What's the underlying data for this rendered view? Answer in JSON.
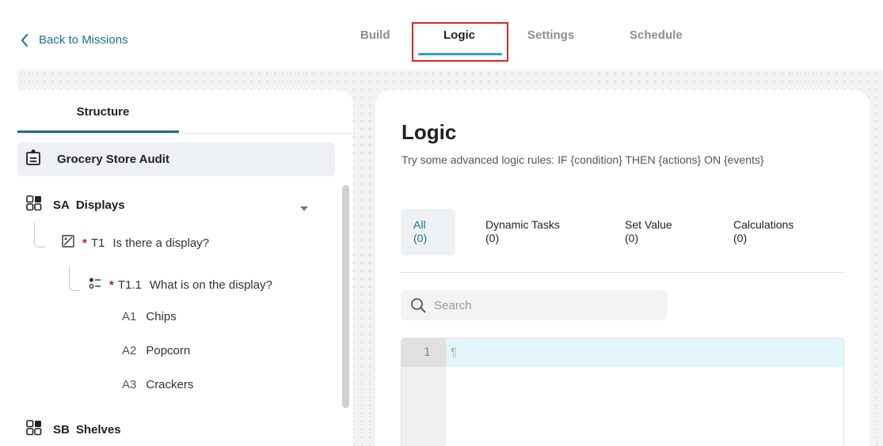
{
  "header": {
    "back_label": "Back to Missions",
    "tabs": [
      {
        "label": "Build"
      },
      {
        "label": "Logic"
      },
      {
        "label": "Settings"
      },
      {
        "label": "Schedule"
      }
    ],
    "active_tab": "Logic"
  },
  "structure": {
    "tab_label": "Structure",
    "root": {
      "label": "Grocery Store Audit"
    },
    "sections": [
      {
        "code": "SA",
        "label": "Displays"
      },
      {
        "code": "SB",
        "label": "Shelves"
      }
    ],
    "tasks": [
      {
        "required_mark": "*",
        "code": "T1",
        "label": "Is there a display?"
      },
      {
        "required_mark": "*",
        "code": "T1.1",
        "label": "What is on the display?"
      }
    ],
    "answers": [
      {
        "code": "A1",
        "label": "Chips"
      },
      {
        "code": "A2",
        "label": "Popcorn"
      },
      {
        "code": "A3",
        "label": "Crackers"
      }
    ]
  },
  "logic": {
    "title": "Logic",
    "subtitle": "Try some advanced logic rules: IF {condition} THEN {actions} ON {events}",
    "filters": [
      {
        "label": "All",
        "count": "(0)"
      },
      {
        "label": "Dynamic Tasks",
        "count": "(0)"
      },
      {
        "label": "Set Value",
        "count": "(0)"
      },
      {
        "label": "Calculations",
        "count": "(0)"
      }
    ],
    "search_placeholder": "Search",
    "editor": {
      "line_number": "1",
      "pilcrow": "¶"
    }
  },
  "colors": {
    "accent": "#1b6f8c",
    "tab_underline": "#2aa7b8",
    "highlight_box": "#e0261f",
    "required_star": "#c8102e"
  }
}
